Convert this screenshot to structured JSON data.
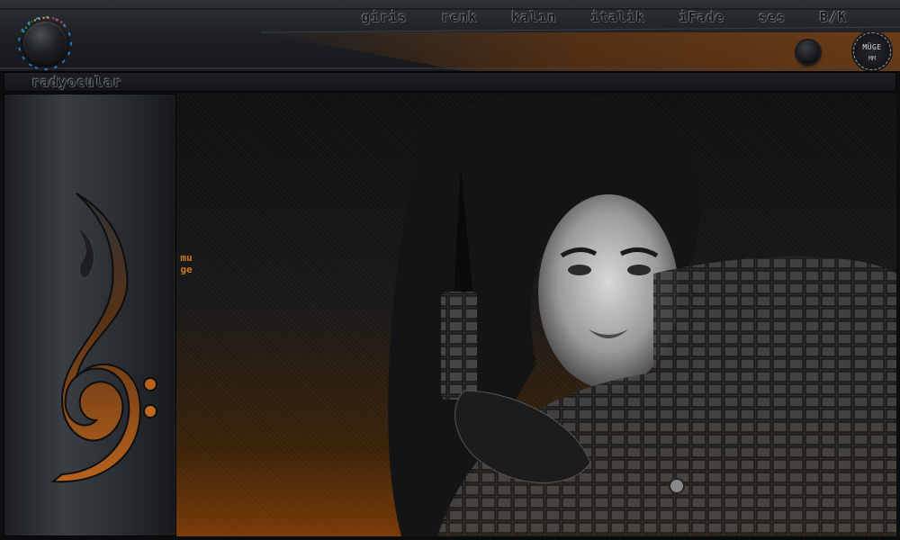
{
  "menu": {
    "items": [
      {
        "id": "giris",
        "label": "giris"
      },
      {
        "id": "renk",
        "label": "renk"
      },
      {
        "id": "kalin",
        "label": "kalın"
      },
      {
        "id": "italik",
        "label": "italik"
      },
      {
        "id": "ifade",
        "label": "iFade"
      },
      {
        "id": "ses",
        "label": "ses"
      },
      {
        "id": "bk",
        "label": "B/K"
      }
    ]
  },
  "radio": {
    "label": "radyocular"
  },
  "logo": {
    "top": "MÜGE",
    "bottom": "MM"
  },
  "nick": {
    "text": "muge"
  },
  "colors": {
    "accent": "#c9761f",
    "glow": "#8a4308",
    "panel": "#2e3136"
  },
  "icons": {
    "knob": "volume-knob-icon",
    "clef": "bass-clef-icon",
    "badge": "logo-badge-icon"
  }
}
